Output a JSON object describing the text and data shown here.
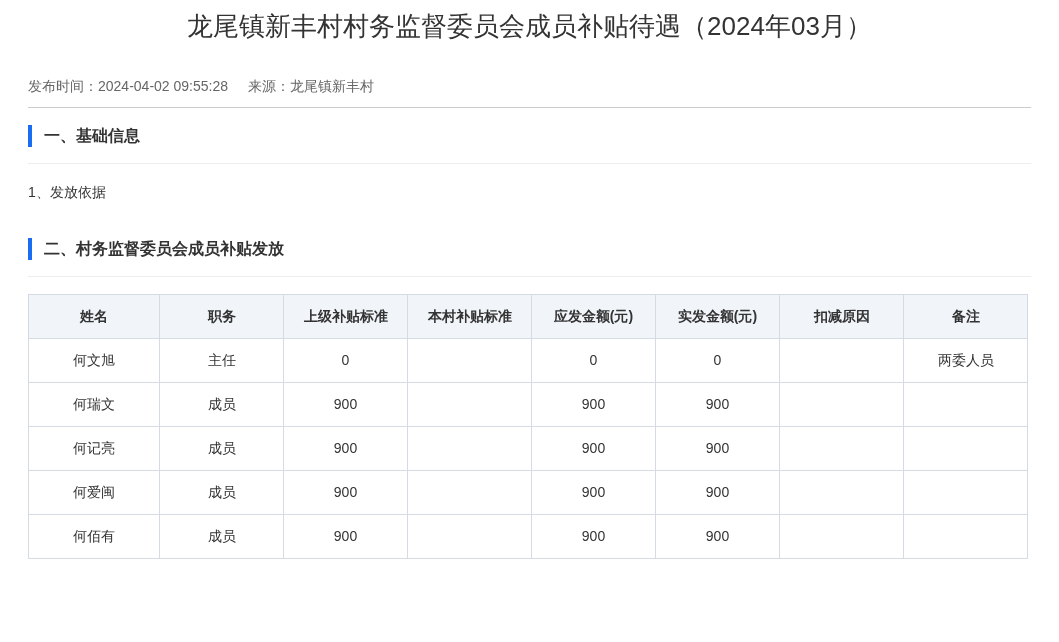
{
  "title": "龙尾镇新丰村村务监督委员会成员补贴待遇（2024年03月）",
  "meta": {
    "publish_label": "发布时间：",
    "publish_time": "2024-04-02 09:55:28",
    "source_label": "来源：",
    "source": "龙尾镇新丰村"
  },
  "sections": [
    {
      "heading": "一、基础信息",
      "paragraphs": [
        "1、发放依据"
      ]
    },
    {
      "heading": "二、村务监督委员会成员补贴发放"
    }
  ],
  "table": {
    "columns": [
      "姓名",
      "职务",
      "上级补贴标准",
      "本村补贴标准",
      "应发金额(元)",
      "实发金额(元)",
      "扣减原因",
      "备注"
    ],
    "rows": [
      [
        "何文旭",
        "主任",
        "0",
        "",
        "0",
        "0",
        "",
        "两委人员"
      ],
      [
        "何瑞文",
        "成员",
        "900",
        "",
        "900",
        "900",
        "",
        ""
      ],
      [
        "何记亮",
        "成员",
        "900",
        "",
        "900",
        "900",
        "",
        ""
      ],
      [
        "何爱闽",
        "成员",
        "900",
        "",
        "900",
        "900",
        "",
        ""
      ],
      [
        "何佰有",
        "成员",
        "900",
        "",
        "900",
        "900",
        "",
        ""
      ]
    ]
  }
}
